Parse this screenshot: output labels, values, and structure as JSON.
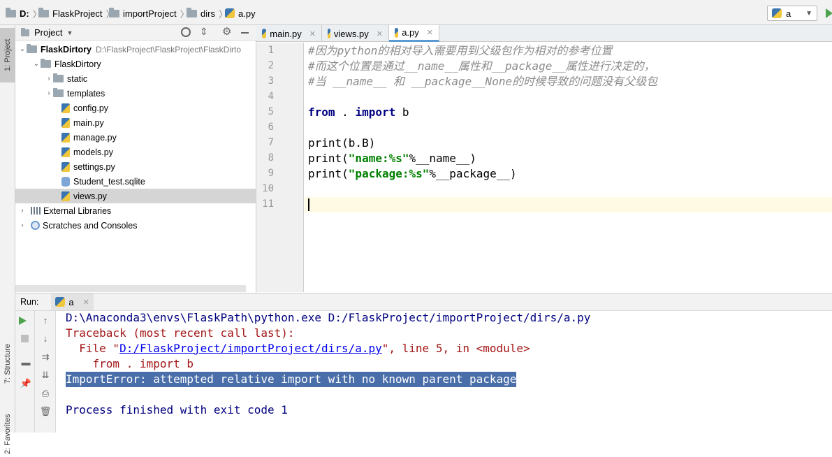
{
  "breadcrumb": [
    "D:",
    "FlaskProject",
    "importProject",
    "dirs",
    "a.py"
  ],
  "run_config": {
    "name": "a"
  },
  "sidebar_tabs": {
    "project": "1: Project",
    "structure": "7: Structure",
    "favorites": "2: Favorites"
  },
  "project_panel": {
    "title": "Project",
    "tree": [
      {
        "label": "FlaskDirtory",
        "path": "D:\\FlaskProject\\FlaskProject\\FlaskDirto"
      },
      {
        "label": "FlaskDirtory"
      },
      {
        "label": "static"
      },
      {
        "label": "templates"
      },
      {
        "label": "config.py"
      },
      {
        "label": "main.py"
      },
      {
        "label": "manage.py"
      },
      {
        "label": "models.py"
      },
      {
        "label": "settings.py"
      },
      {
        "label": "Student_test.sqlite"
      },
      {
        "label": "views.py"
      },
      {
        "label": "External Libraries"
      },
      {
        "label": "Scratches and Consoles"
      }
    ]
  },
  "editor": {
    "tabs": [
      "main.py",
      "views.py",
      "a.py"
    ],
    "active_tab": "a.py",
    "line_numbers": [
      "1",
      "2",
      "3",
      "4",
      "5",
      "6",
      "7",
      "8",
      "9",
      "10",
      "11"
    ],
    "code": {
      "l1": "#因为python的相对导入需要用到父级包作为相对的参考位置",
      "l2": "#而这个位置是通过__name__属性和__package__属性进行决定的，",
      "l3": "#当 __name__ 和 __package__None的时候导致的问题没有父级包",
      "l5_kw1": "from",
      "l5_mid": " . ",
      "l5_kw2": "import",
      "l5_end": " b",
      "l7": "print(b.B)",
      "l8_a": "print(",
      "l8_str": "\"name:%s\"",
      "l8_b": "%__name__)",
      "l9_a": "print(",
      "l9_str": "\"package:%s\"",
      "l9_b": "%__package__)"
    }
  },
  "run_panel": {
    "label": "Run:",
    "tab": "a",
    "output": {
      "cmd": "D:\\Anaconda3\\envs\\FlaskPath\\python.exe D:/FlaskProject/importProject/dirs/a.py",
      "traceback": "Traceback (most recent call last):",
      "file_prefix": "  File \"",
      "file_link": "D:/FlaskProject/importProject/dirs/a.py",
      "file_suffix": "\", line 5, in <module>",
      "stmt": "    from . import b",
      "error": "ImportError: attempted relative import with no known parent package",
      "exit": "Process finished with exit code 1"
    }
  }
}
